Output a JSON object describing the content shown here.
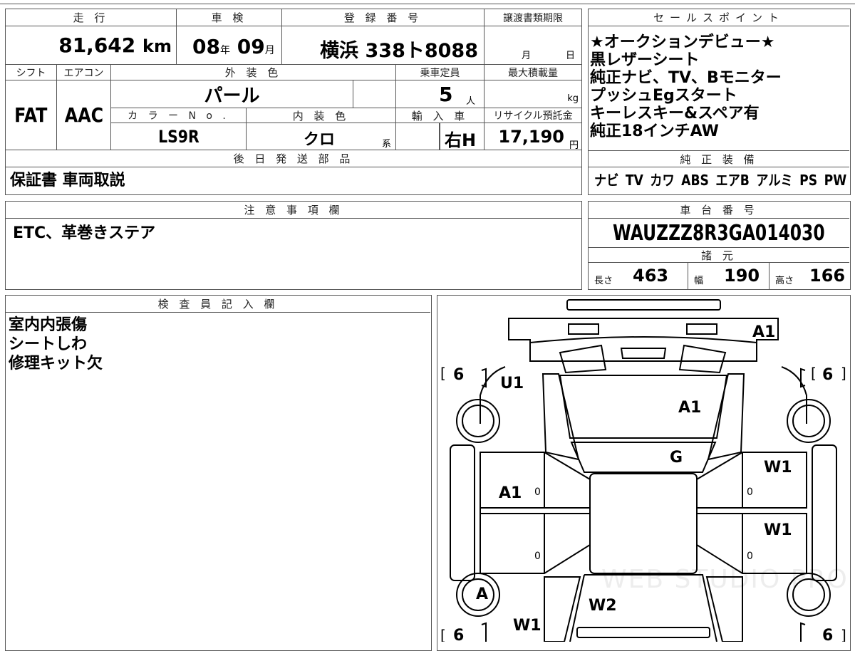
{
  "top_table": {
    "mileage": {
      "header": "走 行",
      "value": "81,642",
      "unit": "km"
    },
    "inspection": {
      "header": "車 検",
      "year": "08",
      "year_unit": "年",
      "month": "09",
      "month_unit": "月"
    },
    "registration": {
      "header": "登 録 番 号",
      "value": "横浜 338ト8088"
    },
    "transfer_deadline": {
      "header": "譲渡書類期限",
      "month_unit": "月",
      "day_unit": "日"
    },
    "shift": {
      "header": "シフト",
      "value": "FAT"
    },
    "aircon": {
      "header": "エアコン",
      "value": "AAC"
    },
    "exterior_color": {
      "header": "外 装 色",
      "value": "パール"
    },
    "capacity": {
      "header": "乗車定員",
      "value": "5",
      "unit": "人"
    },
    "max_load": {
      "header": "最大積載量",
      "unit": "kg"
    },
    "color_no": {
      "header": "カ ラ ー N o .",
      "value": "LS9R"
    },
    "interior_color": {
      "header": "内 装 色",
      "value": "クロ",
      "suffix": "系"
    },
    "import": {
      "header": "輸 入 車",
      "value": "右H"
    },
    "recycle": {
      "header": "リサイクル預託金",
      "value": "17,190",
      "unit": "円"
    },
    "parts": {
      "header": "後 日 発 送 部 品",
      "value": "保証書 車両取説"
    }
  },
  "sales_points": {
    "header": "セールスポイント",
    "lines": [
      "★オークションデビュー★",
      "黒レザーシート",
      "純正ナビ、TV、Bモニター",
      "プッシュEgスタート",
      "キーレスキー&スペア有",
      "純正18インチAW"
    ]
  },
  "equipment": {
    "header": "純 正 装 備",
    "value": "ナビ TV カワ ABS エアB アルミ PS PW"
  },
  "notes": {
    "header": "注 意 事 項 欄",
    "value": "ETC、革巻きステア"
  },
  "chassis": {
    "header": "車 台 番 号",
    "value": "WAUZZZ8R3GA014030"
  },
  "specs": {
    "header": "諸 元",
    "length_label": "長さ",
    "length": "463",
    "width_label": "幅",
    "width": "190",
    "height_label": "高さ",
    "height": "166"
  },
  "inspector": {
    "header": "検 査 員 記 入 欄",
    "lines": [
      "室内内張傷",
      "シートしわ",
      "修理キット欠"
    ]
  },
  "diagram": {
    "marks": {
      "front_bumper": "A1",
      "hood": "A1",
      "front_left_fender": "U1",
      "windshield": "G",
      "front_right_door": "W1",
      "rear_right_door": "W1",
      "left_door": "A1",
      "rear_left": "A",
      "roof": "W2",
      "rear_left_quarter": "W1"
    },
    "tire_marks": {
      "front_left": "6",
      "front_right": "6",
      "rear_left": "6",
      "rear_right": "6"
    },
    "door_counts": [
      "0",
      "0",
      "0",
      "0"
    ],
    "watermark": "WEB STUDIO PRO"
  }
}
